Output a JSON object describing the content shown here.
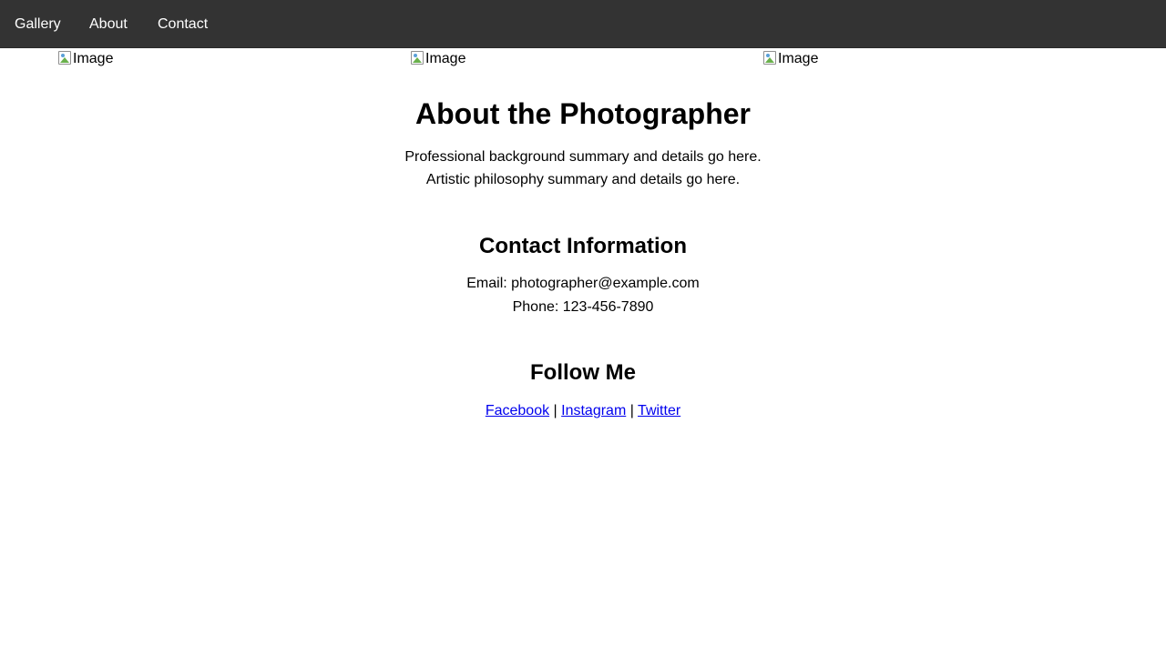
{
  "nav": {
    "items": [
      {
        "label": "Gallery"
      },
      {
        "label": "About"
      },
      {
        "label": "Contact"
      }
    ]
  },
  "gallery": {
    "images": [
      {
        "alt": "Image"
      },
      {
        "alt": "Image"
      },
      {
        "alt": "Image"
      }
    ]
  },
  "about": {
    "title": "About the Photographer",
    "background": "Professional background summary and details go here.",
    "philosophy": "Artistic philosophy summary and details go here."
  },
  "contact": {
    "title": "Contact Information",
    "email": "Email: photographer@example.com",
    "phone": "Phone: 123-456-7890"
  },
  "follow": {
    "title": "Follow Me",
    "links": [
      {
        "label": "Facebook"
      },
      {
        "label": "Instagram"
      },
      {
        "label": "Twitter"
      }
    ],
    "separator": " | "
  },
  "colors": {
    "navbar_bg": "#333333",
    "nav_text": "#ffffff",
    "link": "#0000ee"
  }
}
